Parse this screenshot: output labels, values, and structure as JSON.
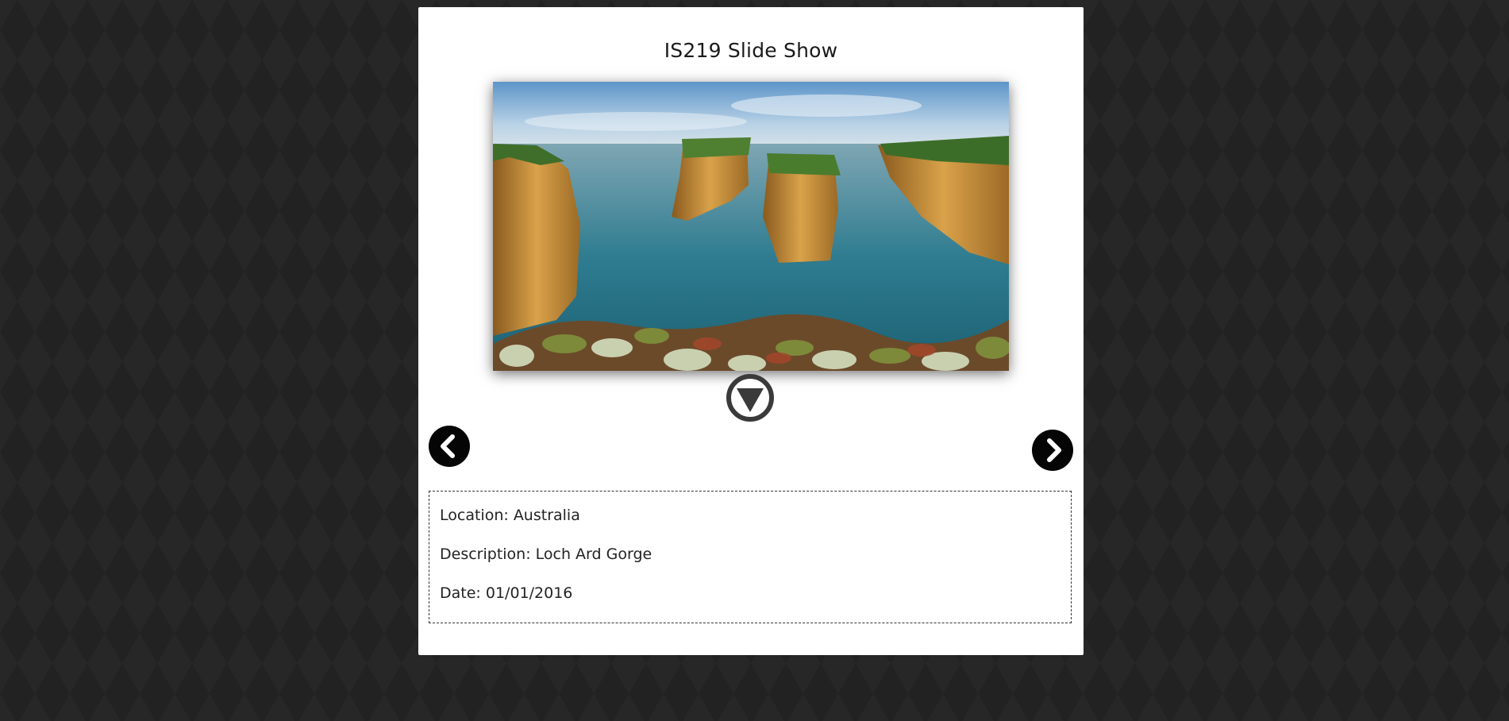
{
  "page": {
    "title": "IS219 Slide Show"
  },
  "slide": {
    "alt_description": "Loch Ard Gorge sea stacks and cliffs"
  },
  "controls": {
    "dropdown_icon": "triangle-down-circle-icon",
    "prev_icon": "chevron-left-icon",
    "next_icon": "chevron-right-icon"
  },
  "details": {
    "location_label": "Location: ",
    "location_value": "Australia",
    "description_label": "Description: ",
    "description_value": "Loch Ard Gorge",
    "date_label": "Date: ",
    "date_value": "01/01/2016"
  },
  "colors": {
    "background": "#222222",
    "panel": "#ffffff",
    "button": "#050505"
  }
}
